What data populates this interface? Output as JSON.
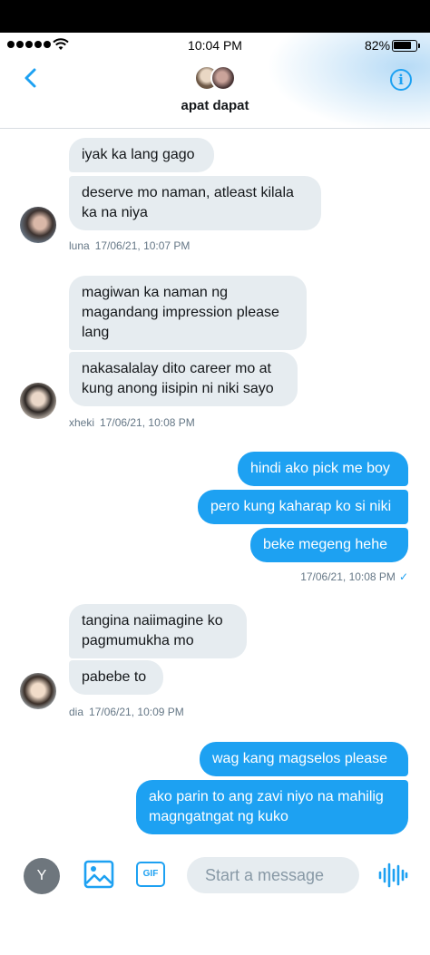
{
  "status_bar": {
    "time": "10:04 PM",
    "battery_pct": "82%",
    "battery_level": 0.82,
    "signal_dots": 5
  },
  "header": {
    "back_icon": "chevron-left-icon",
    "title": "apat dapat",
    "info_icon": "info-icon",
    "info_glyph": "i",
    "accent_color": "#1da1f2"
  },
  "messages": {
    "g1": {
      "m1": "iyak ka lang gago",
      "m2": "deserve mo naman, atleast kilala ka na niya",
      "sender": "luna",
      "time": "17/06/21, 10:07 PM"
    },
    "g2": {
      "m1": "magiwan ka naman ng magandang impression please lang",
      "m2": "nakasalalay dito career mo at kung anong iisipin ni niki sayo",
      "sender": "xheki",
      "time": "17/06/21, 10:08 PM"
    },
    "g3": {
      "m1": "hindi ako pick me boy",
      "m2": "pero kung kaharap ko si niki",
      "m3": "beke megeng hehe",
      "time": "17/06/21, 10:08 PM",
      "check_glyph": "✓"
    },
    "g4": {
      "m1": "tangina naiimagine ko pagmumukha mo",
      "m2": "pabebe to",
      "sender": "dia",
      "time": "17/06/21, 10:09 PM"
    },
    "g5": {
      "m1": "wag kang magselos please",
      "m2": "ako parin to ang zavi niyo na mahilig magngatngat ng kuko"
    }
  },
  "composer": {
    "avatar_letter": "Y",
    "image_icon": "image-icon",
    "gif_label": "GIF",
    "placeholder": "Start a message",
    "voice_icon": "voice-wave-icon"
  }
}
